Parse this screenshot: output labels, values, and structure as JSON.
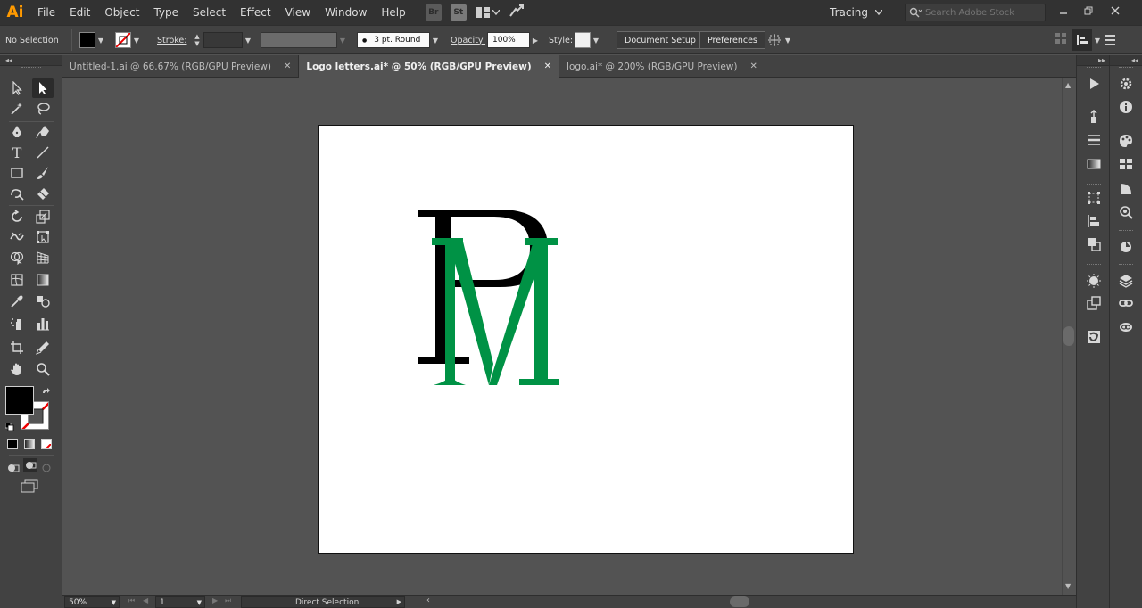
{
  "app": {
    "logo_text": "Ai"
  },
  "menu": [
    "File",
    "Edit",
    "Object",
    "Type",
    "Select",
    "Effect",
    "View",
    "Window",
    "Help"
  ],
  "bridge_icons": {
    "br": "Br",
    "st": "St"
  },
  "workspace": {
    "label": "Tracing"
  },
  "search": {
    "placeholder": "Search Adobe Stock"
  },
  "control_bar": {
    "selection_label": "No Selection",
    "fill_color": "#000000",
    "stroke_label": "Stroke:",
    "brush_label": "3 pt. Round",
    "opacity_label": "Opacity:",
    "opacity_value": "100%",
    "style_label": "Style:",
    "document_setup": "Document Setup",
    "preferences": "Preferences"
  },
  "tabs": [
    {
      "label": "Untitled-1.ai @ 66.67% (RGB/GPU Preview)",
      "active": false
    },
    {
      "label": "Logo letters.ai* @ 50% (RGB/GPU Preview)",
      "active": true
    },
    {
      "label": "logo.ai* @ 200% (RGB/GPU Preview)",
      "active": false
    }
  ],
  "status": {
    "zoom": "50%",
    "artboard_number": "1",
    "tool_name": "Direct Selection"
  },
  "artwork": {
    "letter_p": "P",
    "letter_m": "M",
    "p_color": "#000000",
    "m_color": "#009245"
  },
  "colors": {
    "app_accent": "#ff9a00",
    "artboard_bg": "#ffffff",
    "workspace_bg": "#535353"
  }
}
